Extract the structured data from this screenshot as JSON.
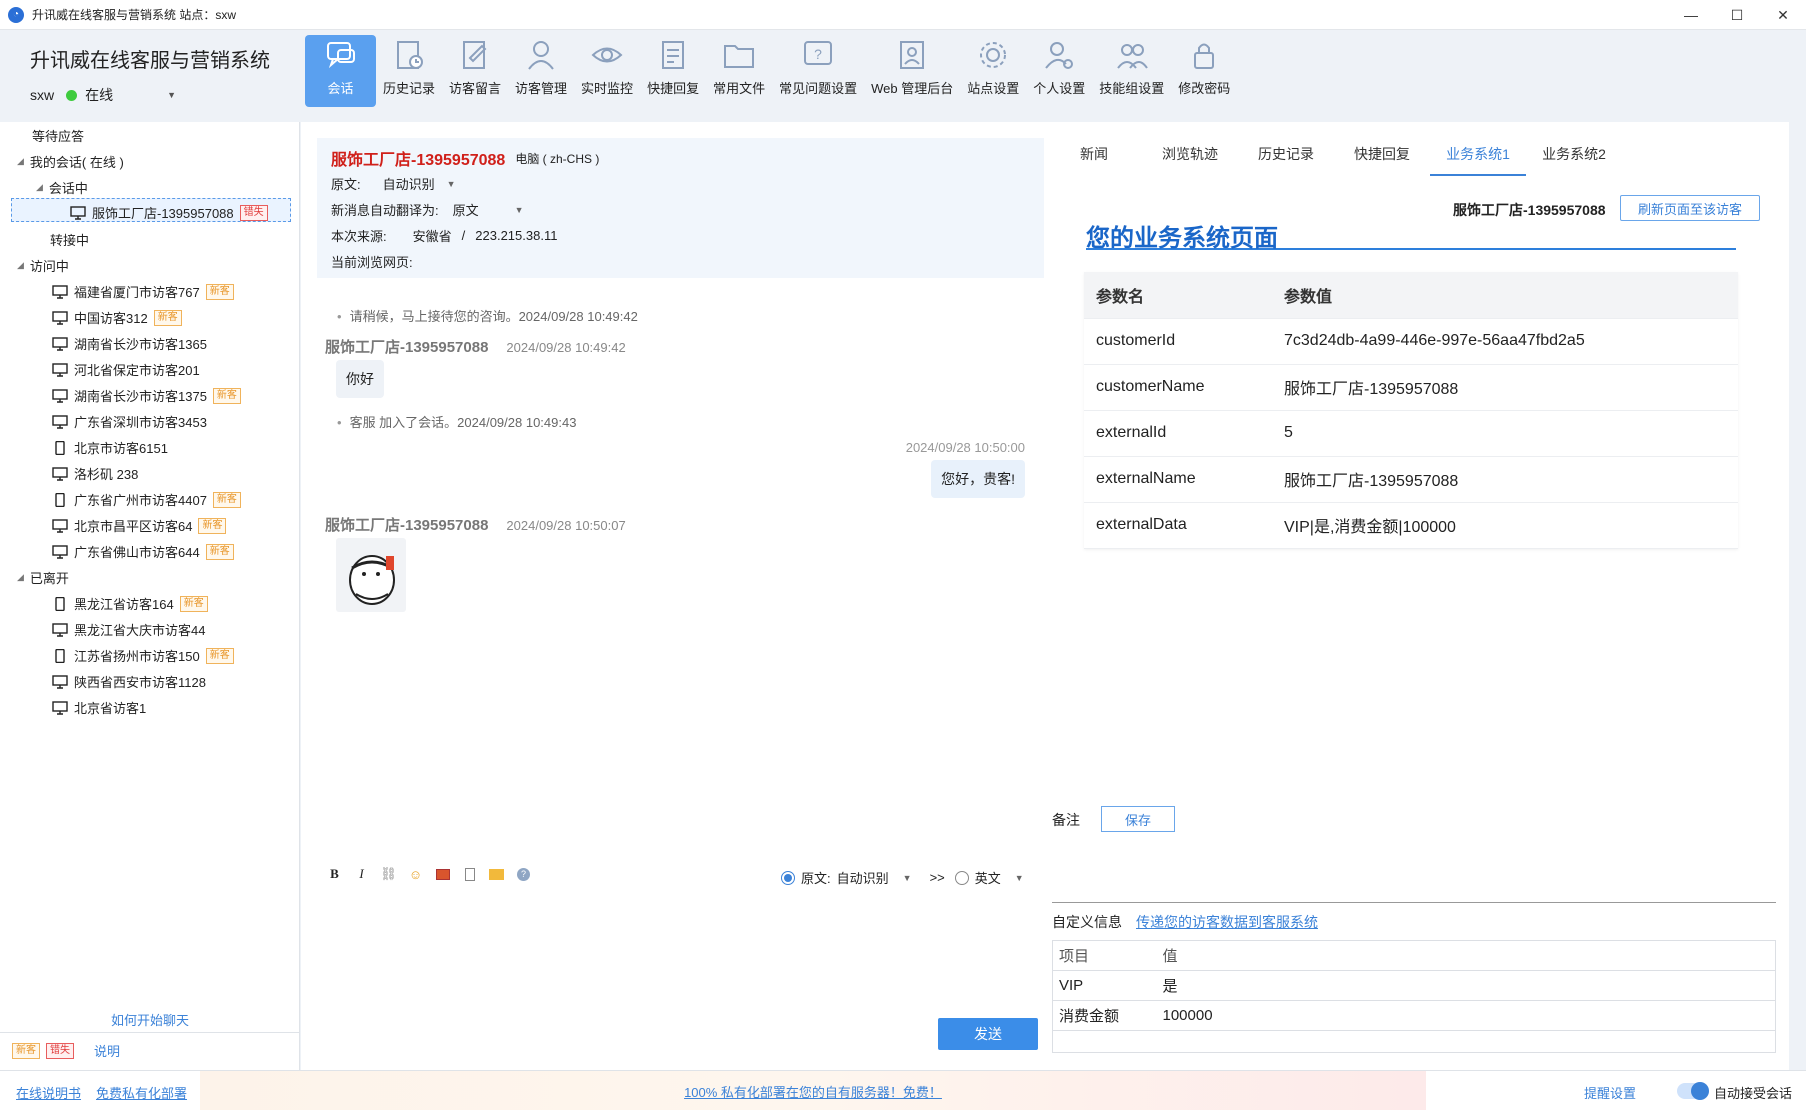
{
  "window": {
    "title": "升讯威在线客服与营销系统  站点：sxw",
    "minimize": "—",
    "maximize": "☐",
    "close": "✕"
  },
  "header": {
    "brand": "升讯威在线客服与营销系统",
    "user": "sxw",
    "status": "在线"
  },
  "toolbar": [
    {
      "label": "会话",
      "icon": "chat-bubbles-icon"
    },
    {
      "label": "历史记录",
      "icon": "history-icon"
    },
    {
      "label": "访客留言",
      "icon": "message-edit-icon"
    },
    {
      "label": "访客管理",
      "icon": "user-search-icon"
    },
    {
      "label": "实时监控",
      "icon": "eye-icon"
    },
    {
      "label": "快捷回复",
      "icon": "quick-reply-icon"
    },
    {
      "label": "常用文件",
      "icon": "folder-icon"
    },
    {
      "label": "常见问题设置",
      "icon": "faq-icon"
    },
    {
      "label": "Web 管理后台",
      "icon": "web-admin-icon"
    },
    {
      "label": "站点设置",
      "icon": "site-settings-icon"
    },
    {
      "label": "个人设置",
      "icon": "personal-settings-icon"
    },
    {
      "label": "技能组设置",
      "icon": "group-icon"
    },
    {
      "label": "修改密码",
      "icon": "lock-icon"
    }
  ],
  "tree": {
    "waiting": "等待应答",
    "my_sessions": "我的会话( 在线 )",
    "in_session": "会话中",
    "active_customer": "服饰工厂店-1395957088",
    "active_badge": "错失",
    "transferring": "转接中",
    "visiting": "访问中",
    "visitors": [
      {
        "name": "福建省厦门市访客767",
        "badge": "新客",
        "device": "pc"
      },
      {
        "name": "中国访客312",
        "badge": "新客",
        "device": "pc"
      },
      {
        "name": "湖南省长沙市访客1365",
        "badge": "",
        "device": "pc"
      },
      {
        "name": "河北省保定市访客201",
        "badge": "",
        "device": "pc"
      },
      {
        "name": "湖南省长沙市访客1375",
        "badge": "新客",
        "device": "pc"
      },
      {
        "name": "广东省深圳市访客3453",
        "badge": "",
        "device": "pc"
      },
      {
        "name": "北京市访客6151",
        "badge": "",
        "device": "mobile"
      },
      {
        "name": "洛杉矶 238",
        "badge": "",
        "device": "pc"
      },
      {
        "name": "广东省广州市访客4407",
        "badge": "新客",
        "device": "mobile"
      },
      {
        "name": "北京市昌平区访客64",
        "badge": "新客",
        "device": "pc"
      },
      {
        "name": "广东省佛山市访客644",
        "badge": "新客",
        "device": "pc"
      }
    ],
    "left": "已离开",
    "left_visitors": [
      {
        "name": "黑龙江省访客164",
        "badge": "新客",
        "device": "mobile"
      },
      {
        "name": "黑龙江省大庆市访客44",
        "badge": "",
        "device": "pc"
      },
      {
        "name": "江苏省扬州市访客150",
        "badge": "新客",
        "device": "mobile"
      },
      {
        "name": "陕西省西安市访客1128",
        "badge": "",
        "device": "pc"
      },
      {
        "name": "北京省访客1",
        "badge": "",
        "device": "pc"
      }
    ],
    "how_to": "如何开始聊天",
    "legend_new": "新客",
    "legend_lost": "错失",
    "legend_desc": "说明"
  },
  "chat": {
    "customer": "服饰工厂店-1395957088",
    "device": "电脑 ( zh-CHS )",
    "source_lang_label": "原文:",
    "source_lang_value": "自动识别",
    "auto_translate_label": "新消息自动翻译为:",
    "auto_translate_value": "原文",
    "source_label": "本次来源:",
    "source_region": "安徽省",
    "source_sep": "/",
    "source_ip": "223.215.38.11",
    "page_label": "当前浏览网页:",
    "messages": {
      "sys1": "请稍候，马上接待您的咨询。2024/09/28 10:49:42",
      "head1_name": "服饰工厂店-1395957088",
      "head1_time": "2024/09/28 10:49:42",
      "msg1": "你好",
      "sys2": "客服 加入了会话。2024/09/28 10:49:43",
      "agent_time": "2024/09/28 10:50:00",
      "agent_msg": "您好，贵客!",
      "head2_name": "服饰工厂店-1395957088",
      "head2_time": "2024/09/28 10:50:07"
    },
    "editor": {
      "bold": "B",
      "italic": "I",
      "src_label": "原文:",
      "src_value": "自动识别",
      "arrow": ">>",
      "target": "英文"
    },
    "send": "发送"
  },
  "right": {
    "tabs": [
      "新闻",
      "浏览轨迹",
      "历史记录",
      "快捷回复",
      "业务系统1",
      "业务系统2"
    ],
    "active_tab": 4,
    "customer": "服饰工厂店-1395957088",
    "refresh": "刷新页面至该访客",
    "biz_title": "您的业务系统页面",
    "param_header": [
      "参数名",
      "参数值"
    ],
    "params": [
      [
        "customerId",
        "7c3d24db-4a99-446e-997e-56aa47fbd2a5"
      ],
      [
        "customerName",
        "服饰工厂店-1395957088"
      ],
      [
        "externalId",
        "5"
      ],
      [
        "externalName",
        "服饰工厂店-1395957088"
      ],
      [
        "externalData",
        "VIP|是,消费金额|100000"
      ]
    ],
    "note_label": "备注",
    "save": "保存",
    "custom_info": "自定义信息",
    "custom_link": "传递您的访客数据到客服系统",
    "kv_header": [
      "项目",
      "值"
    ],
    "kv": [
      [
        "VIP",
        "是"
      ],
      [
        "消费金额",
        "100000"
      ]
    ]
  },
  "footer": {
    "manual": "在线说明书",
    "deploy": "免费私有化部署",
    "promo": "100% 私有化部署在您的自有服务器！免费！",
    "remind": "提醒设置",
    "auto_accept": "自动接受会话"
  },
  "colors": {
    "accent": "#3b82d8",
    "active_tool": "#5aa0ef",
    "customer_name": "#d0201a",
    "online": "#3ecb3e"
  }
}
